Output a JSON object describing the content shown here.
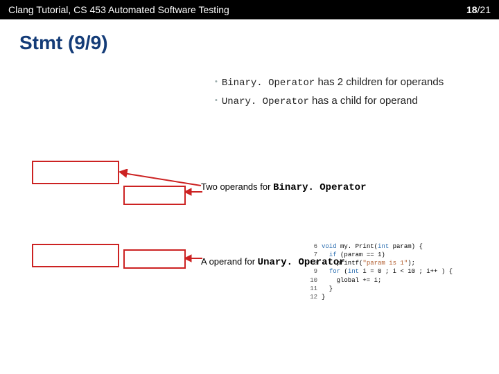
{
  "header": {
    "title": "Clang Tutorial, CS 453 Automated Software Testing",
    "page": "18",
    "total": "/21"
  },
  "slide": {
    "title": "Stmt (9/9)"
  },
  "bullets": {
    "b1_cls": "Binary. Operator",
    "b1_txt": " has 2 children for operands",
    "b2_cls": "Unary. Operator",
    "b2_txt": " has a child for operand"
  },
  "labels": {
    "two_a": "Two operands for ",
    "two_b": "Binary. Operator",
    "one_a": "A operand for ",
    "one_b": "Unary. Operator"
  },
  "code": {
    "lines": [
      {
        "n": "6",
        "pre": "",
        "kw": "void",
        "post": " my. Print(",
        "kw2": "int",
        "post2": " param) {"
      },
      {
        "n": "7",
        "pre": "  ",
        "kw": "if",
        "post": " (param == 1)",
        "kw2": "",
        "post2": ""
      },
      {
        "n": "8",
        "pre": "    printf(",
        "str": "\"param is 1\"",
        "post": ");",
        "kw": "",
        "kw2": "",
        "post2": ""
      },
      {
        "n": "9",
        "pre": "  ",
        "kw": "for",
        "post": " (",
        "kw2": "int",
        "post2": " i = 0 ; i < 10 ; i++ ) {"
      },
      {
        "n": "10",
        "pre": "    global += i;",
        "kw": "",
        "post": "",
        "kw2": "",
        "post2": ""
      },
      {
        "n": "11",
        "pre": "  }",
        "kw": "",
        "post": "",
        "kw2": "",
        "post2": ""
      },
      {
        "n": "12",
        "pre": "}",
        "kw": "",
        "post": "",
        "kw2": "",
        "post2": ""
      }
    ]
  }
}
